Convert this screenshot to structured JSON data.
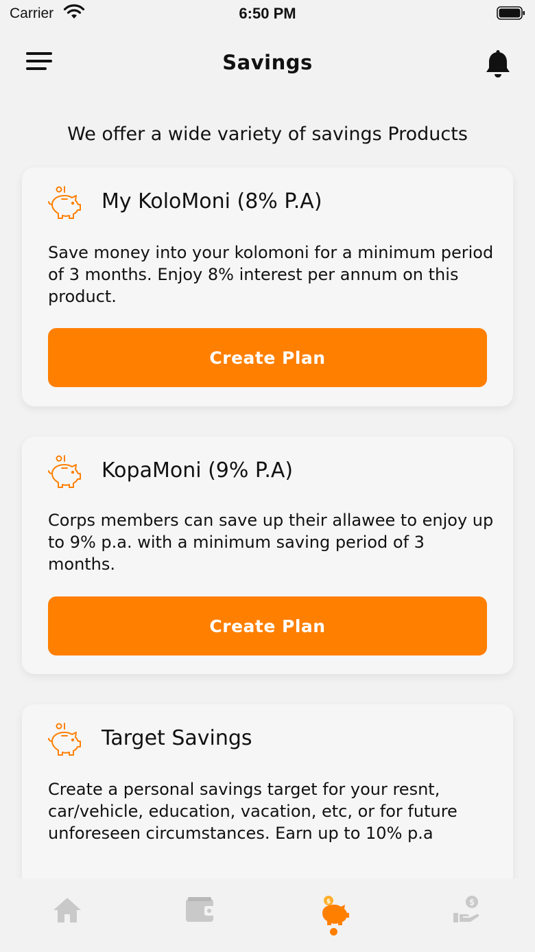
{
  "status_bar": {
    "carrier": "Carrier",
    "time": "6:50 PM"
  },
  "header": {
    "title": "Savings"
  },
  "intro": "We offer a wide variety of savings Products",
  "products": [
    {
      "title": "My KoloMoni (8% P.A)",
      "description": "Save money into your kolomoni for a minimum period of 3 months. Enjoy 8% interest per annum on this product.",
      "button": "Create Plan",
      "icon": "piggy-bank-icon"
    },
    {
      "title": "KopaMoni (9% P.A)",
      "description": "Corps members can save up their allawee to enjoy up to 9% p.a. with a minimum saving period of 3 months.",
      "button": "Create Plan",
      "icon": "piggy-bank-icon"
    },
    {
      "title": "Target Savings",
      "description": "Create a personal savings target for your resnt, car/vehicle, education, vacation, etc, or for future unforeseen circumstances. Earn up to 10% p.a",
      "icon": "piggy-bank-icon"
    }
  ],
  "tab_bar": {
    "tabs": [
      {
        "icon": "home-icon"
      },
      {
        "icon": "wallet-icon"
      },
      {
        "icon": "piggy-bank-icon",
        "active": true
      },
      {
        "icon": "hand-coin-icon"
      }
    ]
  },
  "colors": {
    "accent": "#ff7f00",
    "background": "#f2f2f2",
    "card": "#f6f6f6",
    "inactive_icon": "#c9c9c9"
  }
}
